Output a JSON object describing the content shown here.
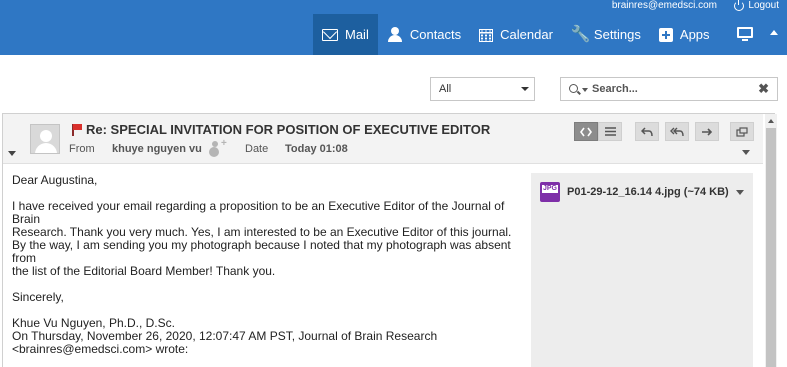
{
  "account": {
    "email": "brainres@emedsci.com",
    "logout_label": "Logout"
  },
  "nav": {
    "mail": "Mail",
    "contacts": "Contacts",
    "calendar": "Calendar",
    "settings": "Settings",
    "apps": "Apps"
  },
  "filter": {
    "selected": "All"
  },
  "search": {
    "placeholder": "Search...",
    "clear": "✖"
  },
  "message": {
    "subject": "Re: SPECIAL INVITATION FOR POSITION OF EXECUTIVE EDITOR",
    "from_label": "From",
    "from_name": "khuye nguyen vu",
    "date_label": "Date",
    "date_value": "Today 01:08",
    "flagged": true,
    "body": {
      "greeting": "Dear Augustina,",
      "para1": "I have received your email regarding a proposition to be an Executive Editor of the Journal of Brain\nResearch.  Thank you very much.  Yes, I am interested to be an Executive Editor of this journal.\nBy the way, I am sending you my photograph because I noted that my photograph was absent from\nthe list of the Editorial Board Member!  Thank you.",
      "closing": "Sincerely,",
      "signature": "Khue Vu Nguyen, Ph.D., D.Sc.",
      "quote1": "On Thursday, November 26, 2020, 12:07:47 AM PST, Journal of Brain Research",
      "quote2": "<brainres@emedsci.com> wrote:"
    },
    "attachment": {
      "type_label": "JPG",
      "name": "P01-29-12_16.14 4.jpg (~74 KB)"
    }
  },
  "colors": {
    "header_blue": "#2f77c4",
    "active_nav": "#1d5f9f",
    "flag_red": "#d9302c",
    "jpg_purple": "#7e2fa8"
  },
  "icons": [
    "mail-icon",
    "contacts-icon",
    "calendar-icon",
    "settings-icon",
    "apps-icon",
    "monitor-icon",
    "search-icon",
    "flag-icon",
    "add-contact-icon",
    "reply-icon",
    "reply-all-icon",
    "forward-icon",
    "popout-icon"
  ]
}
